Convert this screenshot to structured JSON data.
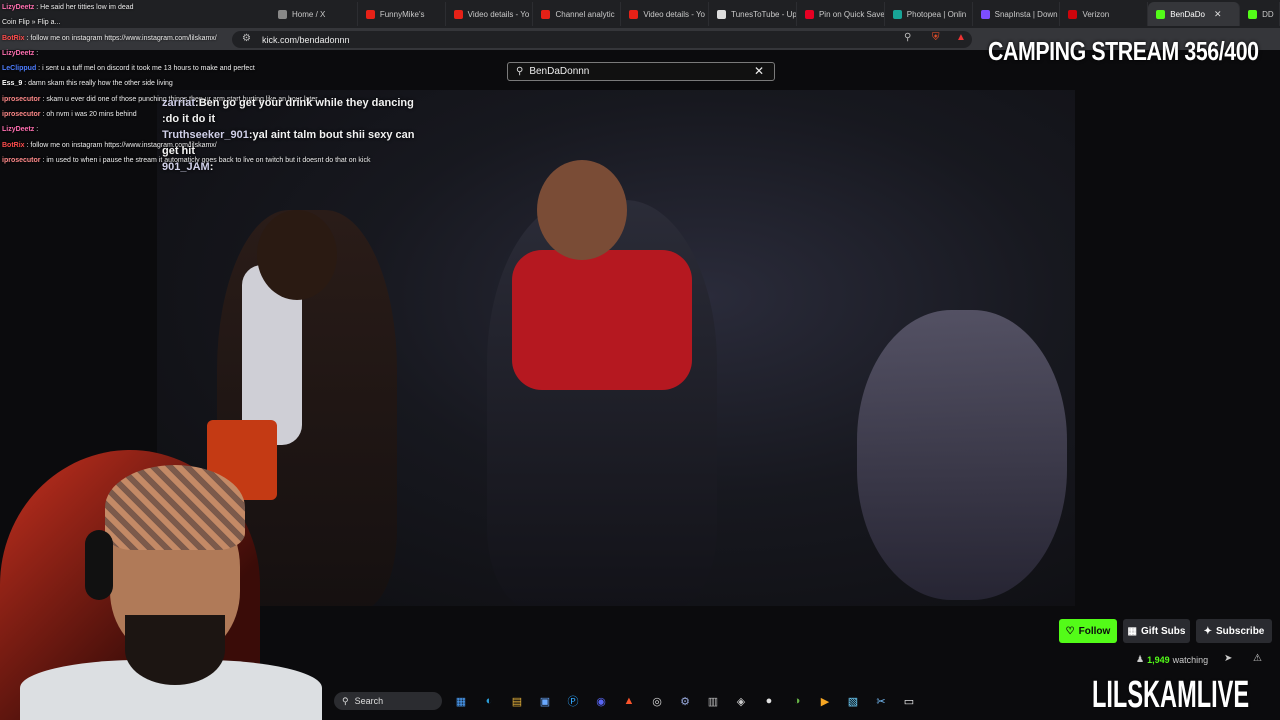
{
  "browser": {
    "tabs": [
      {
        "label": "Home / X",
        "color": "#888888"
      },
      {
        "label": "FunnyMike's",
        "color": "#e62117"
      },
      {
        "label": "Video details - Yo",
        "color": "#e62117"
      },
      {
        "label": "Channel analytic",
        "color": "#e62117"
      },
      {
        "label": "Video details - Yo",
        "color": "#e62117"
      },
      {
        "label": "TunesToTube - Up",
        "color": "#dddddd"
      },
      {
        "label": "Pin on Quick Save",
        "color": "#e60023"
      },
      {
        "label": "Photopea | Onlin",
        "color": "#18a497"
      },
      {
        "label": "SnapInsta | Down",
        "color": "#7c4dff"
      },
      {
        "label": "Verizon",
        "color": "#cd040b"
      },
      {
        "label": "BenDaDo",
        "color": "#53fc18",
        "active": true
      },
      {
        "label": "DD",
        "color": "#53fc18"
      }
    ],
    "address": "kick.com/bendadonnn"
  },
  "search": {
    "value": "BenDaDonnn"
  },
  "channel": {
    "follow_label": "Follow",
    "gift_label": "Gift Subs",
    "subscribe_label": "Subscribe",
    "viewers": "1,949",
    "viewers_suffix": "watching"
  },
  "overlay": {
    "camping": "CAMPING STREAM 356/400",
    "brand": "LILSKAMLIVE"
  },
  "chat": [
    {
      "user": "LizyDeetz",
      "color": "#ff6fb0",
      "text": "He said her titties low im dead"
    },
    {
      "user": "",
      "color": "#ffffff",
      "text": "Coin Flip » Flip a..."
    },
    {
      "user": "BotRix",
      "color": "#ff4d4d",
      "text": "follow me on instagram https://www.instagram.com/lilskamx/"
    },
    {
      "user": "LizyDeetz",
      "color": "#ff6fb0",
      "text": ""
    },
    {
      "user": "LeClippud",
      "color": "#4d7dff",
      "text": "i sent u a tuff mel on discord it took me 13 hours to make and perfect"
    },
    {
      "user": "Ess_9",
      "color": "#ffffff",
      "text": "damn skam this really how the other side living"
    },
    {
      "user": "iprosecutor",
      "color": "#ff8a8a",
      "text": "skam u ever did one of those punching things then ur arm start hurting like an hour later"
    },
    {
      "user": "iprosecutor",
      "color": "#ff8a8a",
      "text": "oh nvm i was 20 mins behind"
    },
    {
      "user": "LizyDeetz",
      "color": "#ff6fb0",
      "text": ""
    },
    {
      "user": "BotRix",
      "color": "#ff4d4d",
      "text": "follow me on instagram https://www.instagram.com/lilskamx/"
    },
    {
      "user": "iprosecutor",
      "color": "#ff8a8a",
      "text": "im used to when i pause the stream it automaticly goes back to live on twitch but it doesnt do that on kick"
    }
  ],
  "video_chat": [
    {
      "user": "zarriat",
      "text": "Ben go get your drink while they dancing"
    },
    {
      "user": "",
      "text": "do it do it"
    },
    {
      "user": "Truthseeker_901",
      "text": "yal aint talm bout shii sexy can get hit"
    },
    {
      "user": "901_JAM",
      "text": ""
    }
  ],
  "taskbar": {
    "search_label": "Search",
    "apps": [
      "files-icon",
      "edge-icon",
      "folder-icon",
      "store-icon",
      "photoshop-icon",
      "discord-icon",
      "brave-icon",
      "chrome-icon",
      "steam-icon",
      "app-icon",
      "obs-icon",
      "game-icon",
      "xbox-icon",
      "fl-studio-icon",
      "notepad-icon",
      "snip-icon",
      "document-icon"
    ]
  }
}
